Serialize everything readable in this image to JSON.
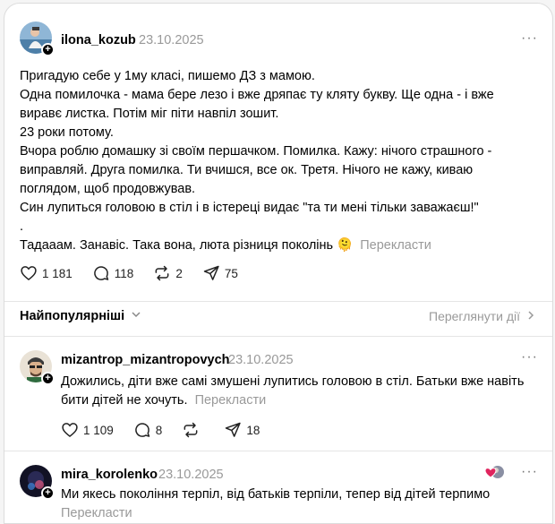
{
  "post": {
    "username": "ilona_kozub",
    "date": "23.10.2025",
    "more": "···",
    "lines": [
      "Пригадую себе у 1му класі, пишемо ДЗ з мамою.",
      "Одна помилочка - мама бере лезо і вже дряпає ту кляту букву. Ще одна - і вже",
      "виравє листка. Потім міг піти навпіл зошит.",
      "23 роки потому.",
      "Вчора роблю домашку зі своїм першачком. Помилка. Кажу: нічого страшного -",
      "виправляй. Друга помилка. Ти вчишся, все ок. Третя. Нічого не кажу, киваю",
      "поглядом, щоб продовжував.",
      "Син лупиться головою в стіл і в істереці видає \"та ти мені тільки заважаєш!\"",
      ".",
      "Тадааам. Занавіс. Така вона, люта різниця поколінь 🫠"
    ],
    "translate": "Перекласти",
    "likes": "1 181",
    "comments": "118",
    "reposts": "2",
    "shares": "75"
  },
  "sort": {
    "label": "Найпопулярніші",
    "view_all": "Переглянути дії"
  },
  "replies": [
    {
      "username": "mizantrop_mizantropovych",
      "date": "23.10.2025",
      "more": "···",
      "lines": [
        "Дожились, діти вже самі змушені лупитись головою в стіл. Батьки вже навіть",
        "бити дітей не хочуть."
      ],
      "translate": "Перекласти",
      "likes": "1 109",
      "comments": "8",
      "reposts": "",
      "shares": "18"
    },
    {
      "username": "mira_korolenko",
      "date": "23.10.2025",
      "more": "···",
      "lines": [
        "Ми якесь покоління терпіл, від батьків терпіли, тепер від дітей терпимо"
      ],
      "translate": "Перекласти"
    }
  ],
  "colors": {
    "text": "#000000",
    "muted": "#999999",
    "divider": "#e5e5e5",
    "heart_red": "#e0245e"
  }
}
